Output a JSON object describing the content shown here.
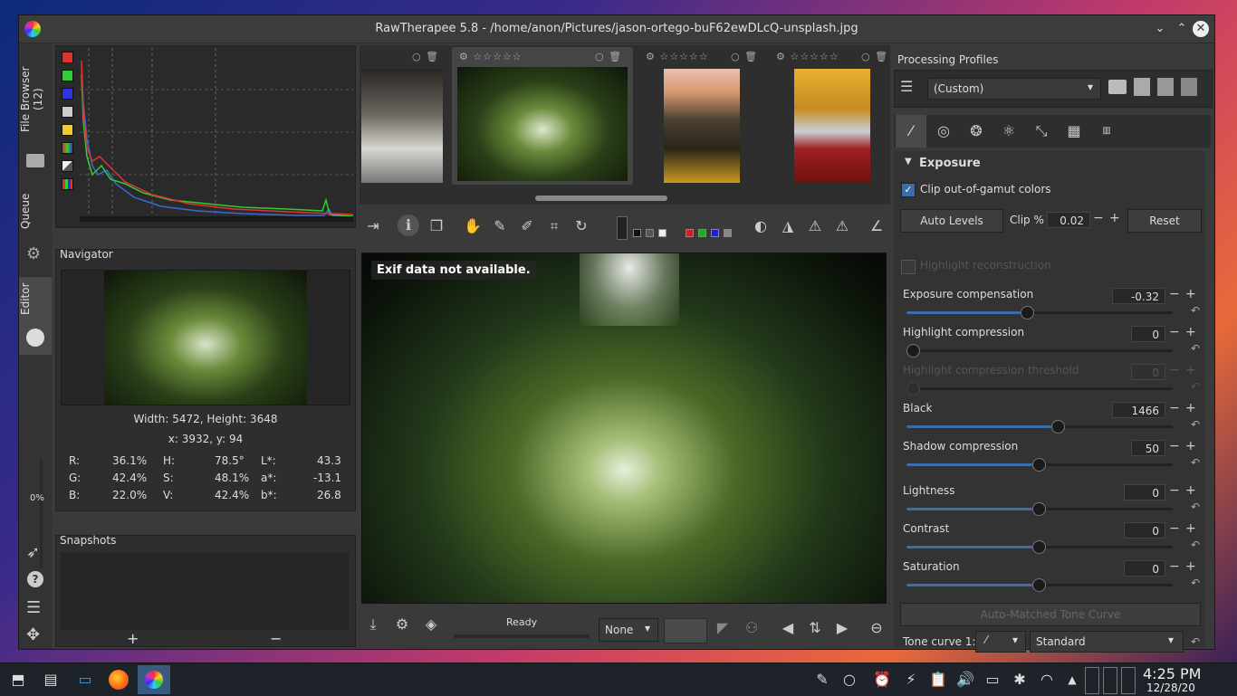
{
  "window": {
    "title": "RawTherapee 5.8 - /home/anon/Pictures/jason-ortego-buF62ewDLcQ-unsplash.jpg"
  },
  "left_tabs": {
    "file_browser": "File Browser (12)",
    "queue": "Queue",
    "editor": "Editor",
    "progress": "0%"
  },
  "navigator": {
    "title": "Navigator",
    "dimensions": "Width: 5472, Height: 3648",
    "coords": "x: 3932, y: 94",
    "rows": [
      {
        "a_label": "R:",
        "a_val": "36.1%",
        "b_label": "H:",
        "b_val": "78.5°",
        "c_label": "L*:",
        "c_val": "43.3"
      },
      {
        "a_label": "G:",
        "a_val": "42.4%",
        "b_label": "S:",
        "b_val": "48.1%",
        "c_label": "a*:",
        "c_val": "-13.1"
      },
      {
        "a_label": "B:",
        "a_val": "22.0%",
        "b_label": "V:",
        "b_val": "42.4%",
        "c_label": "b*:",
        "c_val": "26.8"
      }
    ]
  },
  "snapshots": {
    "title": "Snapshots",
    "add": "+",
    "remove": "−"
  },
  "viewer": {
    "overlay_text": "Exif data not available."
  },
  "status": {
    "ready": "Ready",
    "preview_select": "None"
  },
  "profiles": {
    "title": "Processing Profiles",
    "selected": "(Custom)"
  },
  "exposure": {
    "section_title": "Exposure",
    "clip_label": "Clip out-of-gamut colors",
    "auto_levels": "Auto Levels",
    "clip_pct_label": "Clip %",
    "clip_pct_value": "0.02",
    "reset": "Reset",
    "highlight_reconstruction": "Highlight reconstruction",
    "auto_matched": "Auto-Matched Tone Curve",
    "tone_curve_label": "Tone curve 1:",
    "tone_curve_mode": "Standard",
    "sliders": [
      {
        "label": "Exposure compensation",
        "value": "-0.32",
        "level": 0.45
      },
      {
        "label": "Highlight compression",
        "value": "0",
        "level": 0.0
      },
      {
        "label": "Highlight compression threshold",
        "value": "0",
        "level": 0.0
      },
      {
        "label": "Black",
        "value": "1466",
        "level": 0.57
      },
      {
        "label": "Shadow compression",
        "value": "50",
        "level": 0.5
      },
      {
        "label": "Lightness",
        "value": "0",
        "level": 0.5
      },
      {
        "label": "Contrast",
        "value": "0",
        "level": 0.5
      },
      {
        "label": "Saturation",
        "value": "0",
        "level": 0.5
      }
    ]
  },
  "taskbar": {
    "time": "4:25 PM",
    "date": "12/28/20"
  },
  "colors": {
    "accent": "#3b6ea8",
    "panel": "#2e2e2e",
    "window": "#3a3a3a"
  }
}
